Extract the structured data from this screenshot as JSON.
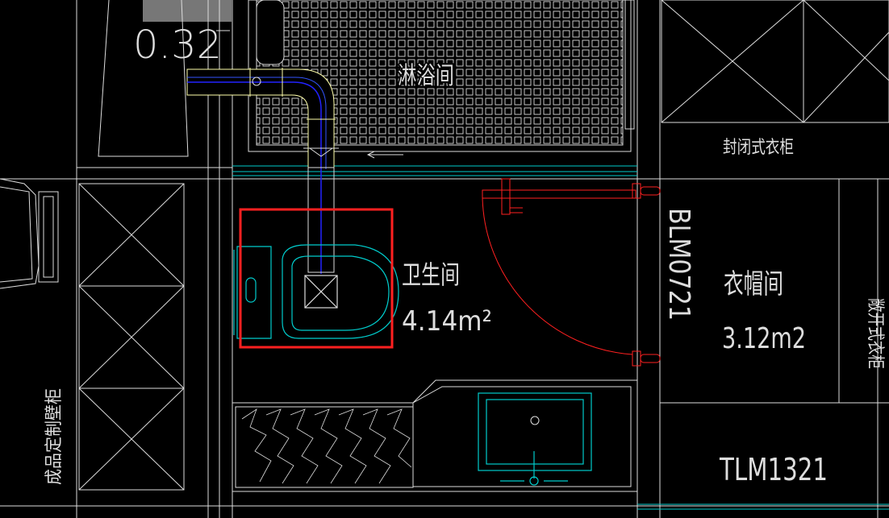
{
  "drawing": {
    "dimension_text": "0.32",
    "rooms": {
      "shower": {
        "name": "淋浴间"
      },
      "toilet": {
        "name": "卫生间",
        "area": "4.14m²"
      },
      "cloakroom": {
        "name": "衣帽间",
        "area": "3.12m2"
      }
    },
    "labels": {
      "closed_wardrobe": "封闭式衣柜",
      "open_wardrobe": "敞开式衣柜",
      "custom_wall_cabinet": "成品定制壁柜"
    },
    "door_codes": {
      "vertical": "BLM0721",
      "horizontal": "TLM1321"
    },
    "colors": {
      "background": "#000000",
      "lines": "#ffffff",
      "fixtures": "#00ffff",
      "pipe": "#0000ff",
      "door": "#ff0000",
      "highlight": "#ff0000",
      "pipe_outline": "#ffff99"
    }
  }
}
